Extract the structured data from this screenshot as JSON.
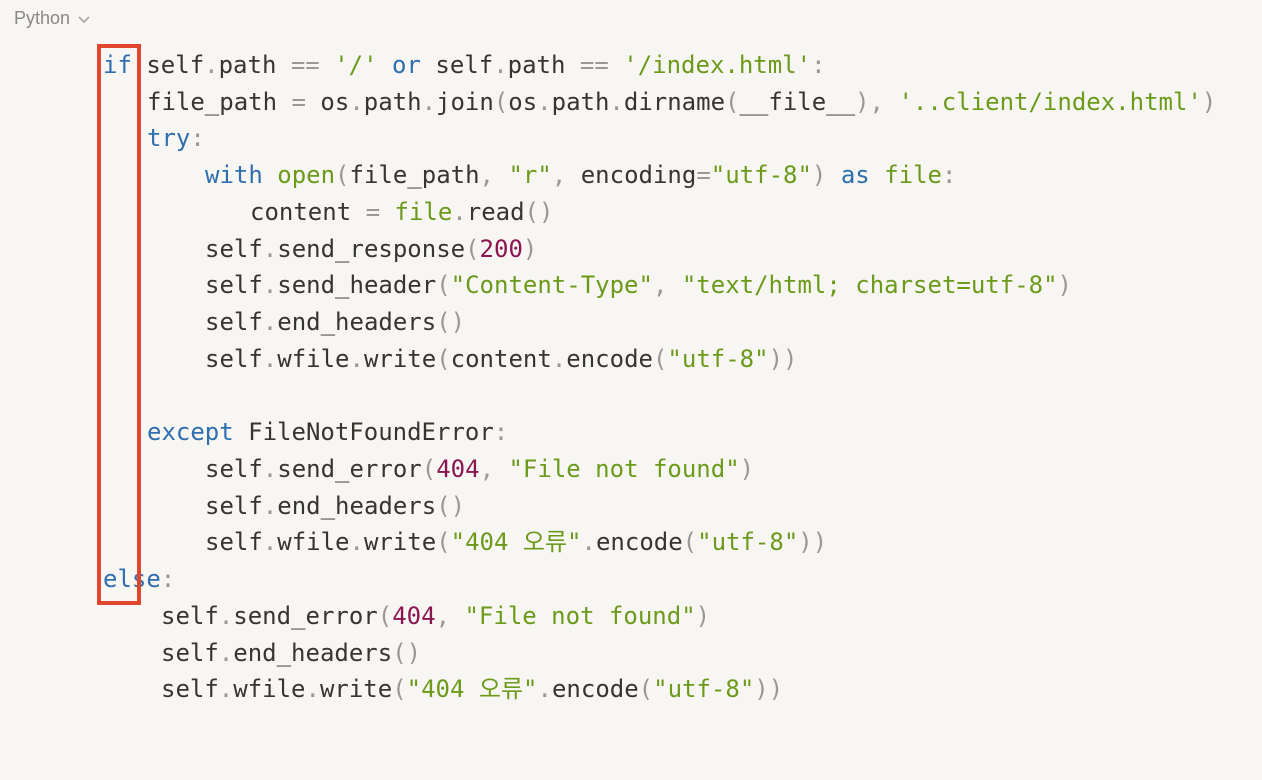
{
  "language_selector": {
    "label": "Python",
    "icon": "chevron-down-icon"
  },
  "highlight": {
    "color": "#e0452e"
  },
  "code": {
    "lines": [
      {
        "tokens": [
          [
            "kw",
            "if"
          ],
          [
            "",
            " self"
          ],
          [
            "p",
            "."
          ],
          [
            "",
            "path "
          ],
          [
            "p",
            "=="
          ],
          [
            "",
            " "
          ],
          [
            "str",
            "'/'"
          ],
          [
            "",
            " "
          ],
          [
            "kw",
            "or"
          ],
          [
            "",
            " self"
          ],
          [
            "p",
            "."
          ],
          [
            "",
            "path "
          ],
          [
            "p",
            "=="
          ],
          [
            "",
            " "
          ],
          [
            "str",
            "'/index.html'"
          ],
          [
            "p",
            ":"
          ]
        ]
      },
      {
        "tokens": [
          [
            "",
            "file_path "
          ],
          [
            "p",
            "="
          ],
          [
            "",
            " os"
          ],
          [
            "p",
            "."
          ],
          [
            "",
            "path"
          ],
          [
            "p",
            "."
          ],
          [
            "",
            "join"
          ],
          [
            "p",
            "("
          ],
          [
            "",
            "os"
          ],
          [
            "p",
            "."
          ],
          [
            "",
            "path"
          ],
          [
            "p",
            "."
          ],
          [
            "",
            "dirname"
          ],
          [
            "p",
            "("
          ],
          [
            "",
            "__file__"
          ],
          [
            "p",
            ")"
          ],
          [
            "p",
            ","
          ],
          [
            "",
            " "
          ],
          [
            "str",
            "'..client/index.html'"
          ],
          [
            "p",
            ")"
          ]
        ]
      },
      {
        "tokens": [
          [
            "kw",
            "try"
          ],
          [
            "p",
            ":"
          ]
        ]
      },
      {
        "tokens": [
          [
            "kw",
            "with"
          ],
          [
            "",
            " "
          ],
          [
            "fn",
            "open"
          ],
          [
            "p",
            "("
          ],
          [
            "",
            "file_path"
          ],
          [
            "p",
            ","
          ],
          [
            "",
            " "
          ],
          [
            "str",
            "\"r\""
          ],
          [
            "p",
            ","
          ],
          [
            "",
            " encoding"
          ],
          [
            "p",
            "="
          ],
          [
            "str",
            "\"utf-8\""
          ],
          [
            "p",
            ")"
          ],
          [
            "",
            " "
          ],
          [
            "kw",
            "as"
          ],
          [
            "",
            " "
          ],
          [
            "fn",
            "file"
          ],
          [
            "p",
            ":"
          ]
        ]
      },
      {
        "tokens": [
          [
            "",
            "content "
          ],
          [
            "p",
            "="
          ],
          [
            "",
            " "
          ],
          [
            "fn",
            "file"
          ],
          [
            "p",
            "."
          ],
          [
            "",
            "read"
          ],
          [
            "p",
            "()"
          ]
        ]
      },
      {
        "tokens": [
          [
            "",
            "self"
          ],
          [
            "p",
            "."
          ],
          [
            "",
            "send_response"
          ],
          [
            "p",
            "("
          ],
          [
            "num",
            "200"
          ],
          [
            "p",
            ")"
          ]
        ]
      },
      {
        "tokens": [
          [
            "",
            "self"
          ],
          [
            "p",
            "."
          ],
          [
            "",
            "send_header"
          ],
          [
            "p",
            "("
          ],
          [
            "str",
            "\"Content-Type\""
          ],
          [
            "p",
            ","
          ],
          [
            "",
            " "
          ],
          [
            "str",
            "\"text/html; charset=utf-8\""
          ],
          [
            "p",
            ")"
          ]
        ]
      },
      {
        "tokens": [
          [
            "",
            "self"
          ],
          [
            "p",
            "."
          ],
          [
            "",
            "end_headers"
          ],
          [
            "p",
            "()"
          ]
        ]
      },
      {
        "tokens": [
          [
            "",
            "self"
          ],
          [
            "p",
            "."
          ],
          [
            "",
            "wfile"
          ],
          [
            "p",
            "."
          ],
          [
            "",
            "write"
          ],
          [
            "p",
            "("
          ],
          [
            "",
            "content"
          ],
          [
            "p",
            "."
          ],
          [
            "",
            "encode"
          ],
          [
            "p",
            "("
          ],
          [
            "str",
            "\"utf-8\""
          ],
          [
            "p",
            "))"
          ]
        ]
      },
      {
        "tokens": []
      },
      {
        "tokens": [
          [
            "kw",
            "except"
          ],
          [
            "",
            " FileNotFoundError"
          ],
          [
            "p",
            ":"
          ]
        ]
      },
      {
        "tokens": [
          [
            "",
            "self"
          ],
          [
            "p",
            "."
          ],
          [
            "",
            "send_error"
          ],
          [
            "p",
            "("
          ],
          [
            "num",
            "404"
          ],
          [
            "p",
            ","
          ],
          [
            "",
            " "
          ],
          [
            "str",
            "\"File not found\""
          ],
          [
            "p",
            ")"
          ]
        ]
      },
      {
        "tokens": [
          [
            "",
            "self"
          ],
          [
            "p",
            "."
          ],
          [
            "",
            "end_headers"
          ],
          [
            "p",
            "()"
          ]
        ]
      },
      {
        "tokens": [
          [
            "",
            "self"
          ],
          [
            "p",
            "."
          ],
          [
            "",
            "wfile"
          ],
          [
            "p",
            "."
          ],
          [
            "",
            "write"
          ],
          [
            "p",
            "("
          ],
          [
            "str",
            "\"404 오류\""
          ],
          [
            "p",
            "."
          ],
          [
            "",
            "encode"
          ],
          [
            "p",
            "("
          ],
          [
            "str",
            "\"utf-8\""
          ],
          [
            "p",
            "))"
          ]
        ]
      },
      {
        "tokens": [
          [
            "kw",
            "else"
          ],
          [
            "p",
            ":"
          ]
        ]
      },
      {
        "tokens": [
          [
            "",
            "self"
          ],
          [
            "p",
            "."
          ],
          [
            "",
            "send_error"
          ],
          [
            "p",
            "("
          ],
          [
            "num",
            "404"
          ],
          [
            "p",
            ","
          ],
          [
            "",
            " "
          ],
          [
            "str",
            "\"File not found\""
          ],
          [
            "p",
            ")"
          ]
        ]
      },
      {
        "tokens": [
          [
            "",
            "self"
          ],
          [
            "p",
            "."
          ],
          [
            "",
            "end_headers"
          ],
          [
            "p",
            "()"
          ]
        ]
      },
      {
        "tokens": [
          [
            "",
            "self"
          ],
          [
            "p",
            "."
          ],
          [
            "",
            "wfile"
          ],
          [
            "p",
            "."
          ],
          [
            "",
            "write"
          ],
          [
            "p",
            "("
          ],
          [
            "str",
            "\"404 오류\""
          ],
          [
            "p",
            "."
          ],
          [
            "",
            "encode"
          ],
          [
            "p",
            "("
          ],
          [
            "str",
            "\"utf-8\""
          ],
          [
            "p",
            "))"
          ]
        ]
      }
    ]
  }
}
